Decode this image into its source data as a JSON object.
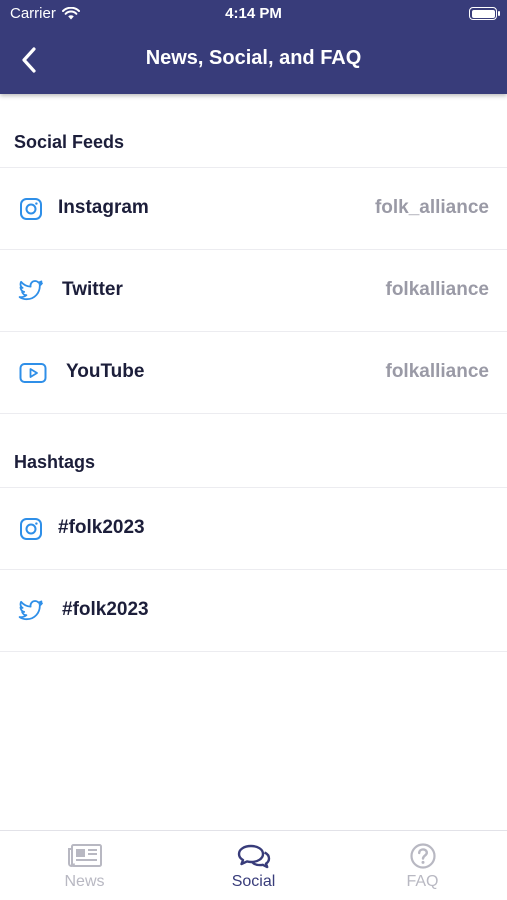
{
  "status_bar": {
    "carrier": "Carrier",
    "time": "4:14 PM"
  },
  "nav": {
    "title": "News, Social, and FAQ",
    "back_icon": "chevron-left-icon"
  },
  "colors": {
    "header_bg": "#383c7a",
    "icon_blue": "#2f8fe8",
    "active_tab": "#383c7a",
    "inactive_tab": "#b8b8c2",
    "handle_text": "#9a9aa6"
  },
  "sections": {
    "social_feeds": {
      "title": "Social Feeds",
      "items": [
        {
          "icon": "instagram-icon",
          "label": "Instagram",
          "handle": "folk_alliance"
        },
        {
          "icon": "twitter-icon",
          "label": "Twitter",
          "handle": "folkalliance"
        },
        {
          "icon": "youtube-icon",
          "label": "YouTube",
          "handle": "folkalliance"
        }
      ]
    },
    "hashtags": {
      "title": "Hashtags",
      "items": [
        {
          "icon": "instagram-icon",
          "label": "#folk2023"
        },
        {
          "icon": "twitter-icon",
          "label": "#folk2023"
        }
      ]
    }
  },
  "tabbar": {
    "tabs": [
      {
        "icon": "newspaper-icon",
        "label": "News",
        "active": false
      },
      {
        "icon": "chat-bubbles-icon",
        "label": "Social",
        "active": true
      },
      {
        "icon": "question-circle-icon",
        "label": "FAQ",
        "active": false
      }
    ]
  }
}
